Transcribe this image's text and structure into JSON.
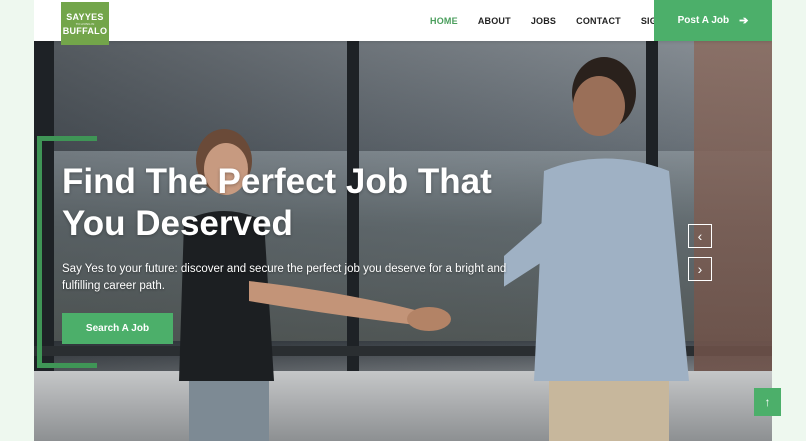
{
  "brand": {
    "logo_line1": "SAYYES",
    "logo_line2": "TO LIVING IN",
    "logo_line3": "BUFFALO",
    "color": "#73a54a"
  },
  "nav": {
    "items": [
      {
        "label": "HOME",
        "active": true
      },
      {
        "label": "ABOUT",
        "active": false
      },
      {
        "label": "JOBS",
        "active": false
      },
      {
        "label": "CONTACT",
        "active": false
      },
      {
        "label": "SIGN IN",
        "active": false
      }
    ],
    "active_color": "#4a9e5c"
  },
  "header_cta": {
    "label": "Post A Job",
    "icon": "arrow-right-icon"
  },
  "hero": {
    "headline": "Find The Perfect Job That You Deserved",
    "subtext": "Say Yes to your future: discover and secure the perfect job you deserve for a bright and fulfilling career path.",
    "button_label": "Search A Job",
    "accent_color": "#4caf6a",
    "prev_icon": "chevron-left-icon",
    "next_icon": "chevron-right-icon"
  },
  "scroll_top": {
    "icon": "arrow-up-icon"
  }
}
